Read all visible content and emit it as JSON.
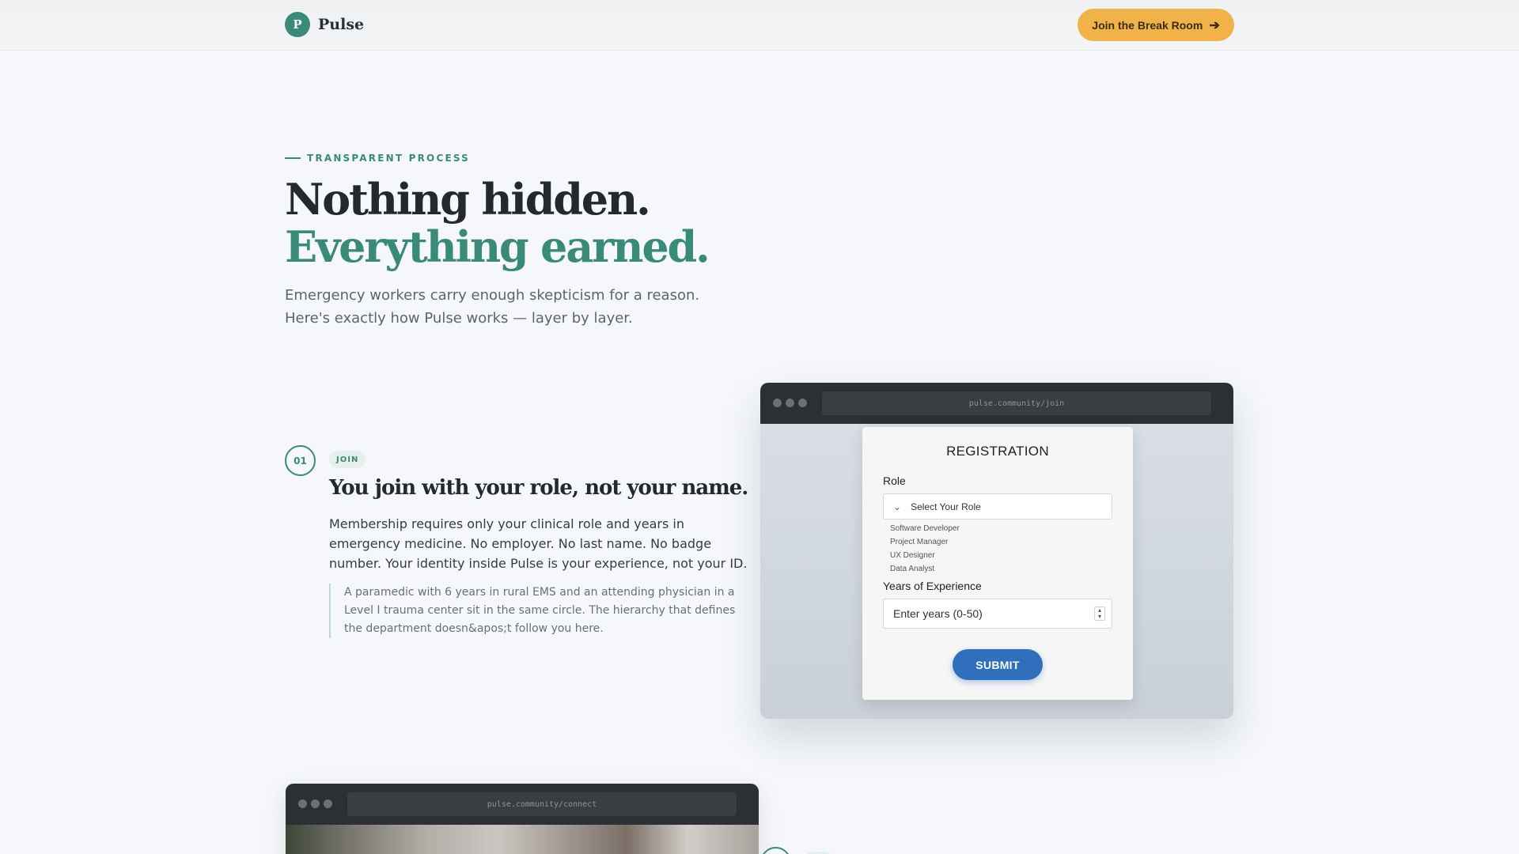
{
  "header": {
    "logo_letter": "P",
    "brand": "Pulse",
    "cta_label": "Join the Break Room",
    "cta_icon": "arrow-right-icon"
  },
  "hero": {
    "eyebrow": "TRANSPARENT PROCESS",
    "title_line1": "Nothing hidden.",
    "title_line2": "Everything earned.",
    "lead": "Emergency workers carry enough skepticism for a reason. Here's exactly how Pulse works — layer by layer."
  },
  "steps": [
    {
      "number": "01",
      "badge": "JOIN",
      "title": "You join with your role, not your name.",
      "body": "Membership requires only your clinical role and years in emergency medicine. No employer. No last name. No badge number. Your identity inside Pulse is your experience, not your ID.",
      "quote": "A paramedic with 6 years in rural EMS and an attending physician in a Level I trauma center sit in the same circle. The hierarchy that defines the department doesn&apos;t follow you here."
    }
  ],
  "mock_join": {
    "url": "pulse.community/join",
    "form": {
      "title": "REGISTRATION",
      "role_label": "Role",
      "role_placeholder": "Select Your Role",
      "role_options": [
        "Software Developer",
        "Project Manager",
        "UX Designer",
        "Data Analyst"
      ],
      "years_label": "Years of Experience",
      "years_placeholder": "Enter years (0-50)",
      "submit_label": "SUBMIT"
    }
  },
  "mock_connect": {
    "url": "pulse.community/connect"
  },
  "colors": {
    "accent": "#3a8a7a",
    "cta": "#f2b24a",
    "submit": "#2f6fbb",
    "background": "#f5f7fa"
  }
}
